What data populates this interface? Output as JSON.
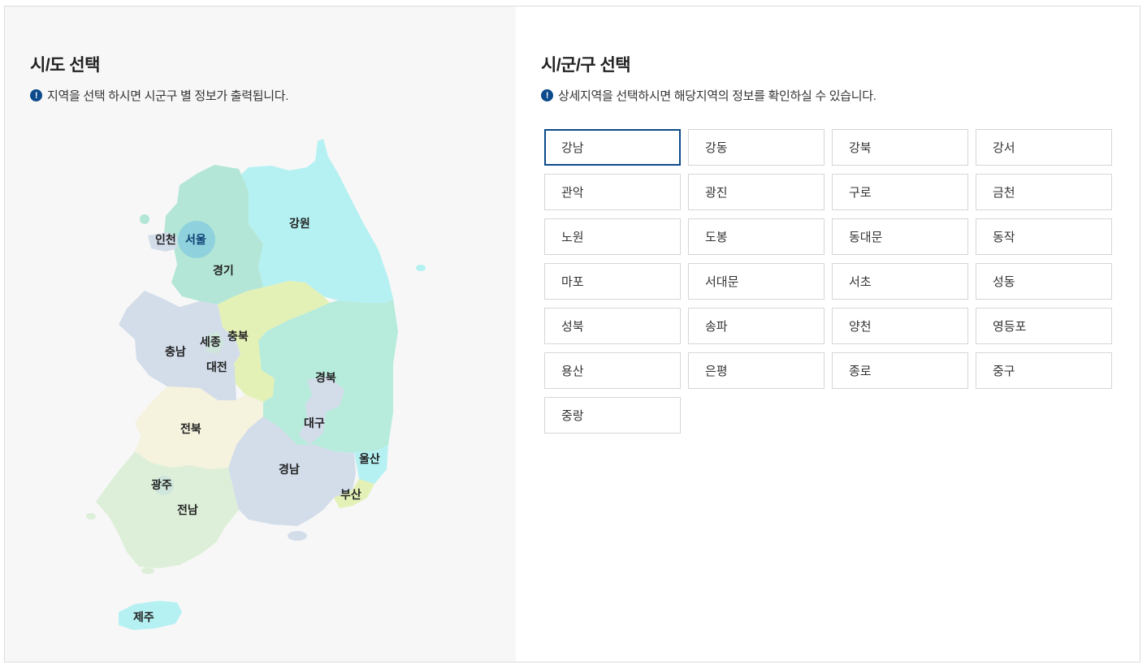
{
  "left": {
    "title": "시/도 선택",
    "notice": "지역을 선택 하시면 시군구 별 정보가 출력됩니다.",
    "regions": {
      "incheon": "인천",
      "seoul": "서울",
      "gyeonggi": "경기",
      "gangwon": "강원",
      "chungnam": "충남",
      "sejong": "세종",
      "chungbuk": "충북",
      "daejeon": "대전",
      "gyeongbuk": "경북",
      "daegu": "대구",
      "jeonbuk": "전북",
      "gyeongnam": "경남",
      "ulsan": "울산",
      "gwangju": "광주",
      "busan": "부산",
      "jeonnam": "전남",
      "jeju": "제주"
    },
    "selected_region": "서울"
  },
  "right": {
    "title": "시/군/구 선택",
    "notice": "상세지역을 선택하시면 해당지역의 정보를 확인하실 수 있습니다.",
    "districts": [
      "강남",
      "강동",
      "강북",
      "강서",
      "관악",
      "광진",
      "구로",
      "금천",
      "노원",
      "도봉",
      "동대문",
      "동작",
      "마포",
      "서대문",
      "서초",
      "성동",
      "성북",
      "송파",
      "양천",
      "영등포",
      "용산",
      "은평",
      "종로",
      "중구",
      "중랑"
    ],
    "selected_district": "강남"
  },
  "colors": {
    "accent": "#0c4a8c",
    "gangwon": "#b5f1f2",
    "gyeonggi": "#b3e6d6",
    "chungnam": "#d3ddea",
    "chungbuk": "#e3f1b6",
    "gyeongbuk": "#b7ebdc",
    "jeonbuk": "#f5f2dd",
    "gyeongnam": "#d3ddea",
    "jeonnam": "#ddefd9",
    "jeju": "#b5f1f2"
  }
}
